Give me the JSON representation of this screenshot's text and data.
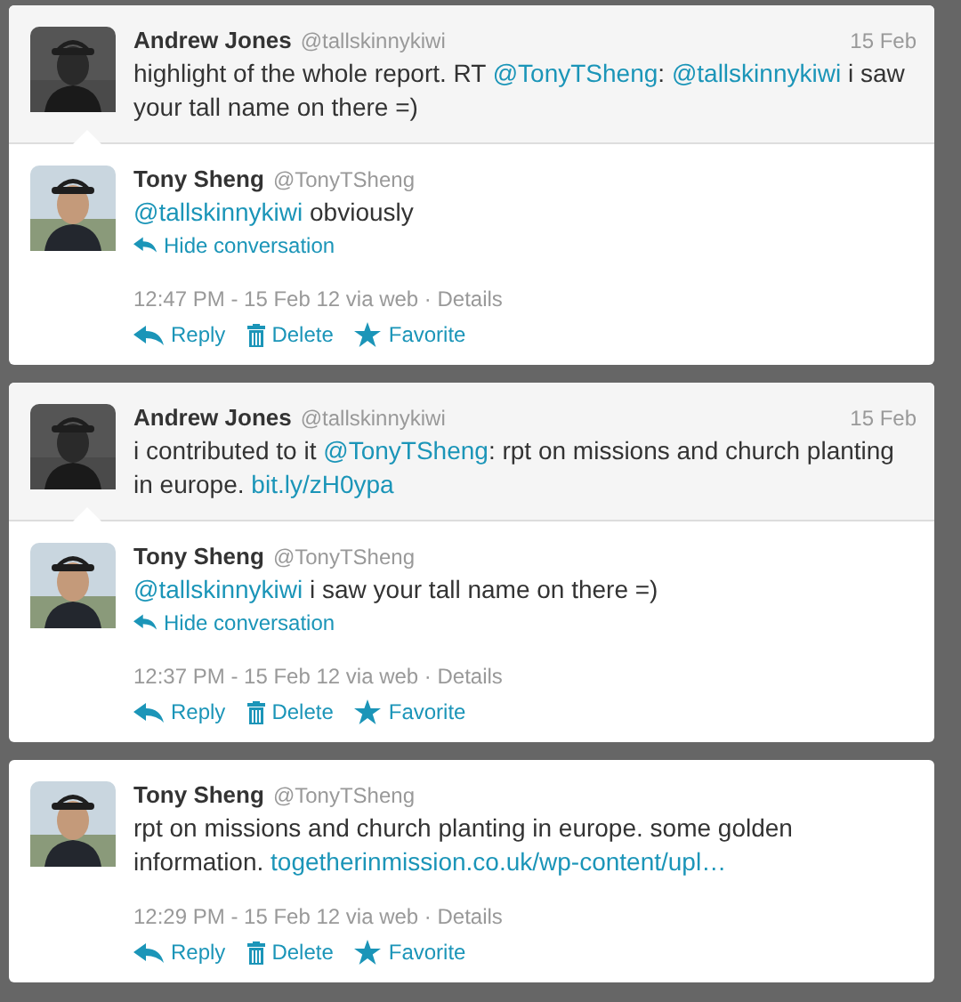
{
  "tweets": [
    {
      "parent": {
        "name": "Andrew Jones",
        "handle": "@tallskinnykiwi",
        "date": "15 Feb",
        "avatar": {
          "kind": "picture"
        },
        "text": [
          {
            "kind": "plain",
            "text": "highlight of the whole report. RT "
          },
          {
            "kind": "link",
            "text": "@TonyTSheng"
          },
          {
            "kind": "plain",
            "text": ": "
          },
          {
            "kind": "link",
            "text": "@tallskinnykiwi"
          },
          {
            "kind": "plain",
            "text": " i saw your tall name on there =)"
          }
        ]
      },
      "name": "Tony Sheng",
      "handle": "@TonyTSheng",
      "avatar": {
        "kind": "picture"
      },
      "text": [
        {
          "kind": "link",
          "text": "@tallskinnykiwi"
        },
        {
          "kind": "plain",
          "text": " obviously"
        }
      ],
      "conversation_link": "Hide conversation",
      "meta": "12:47 PM - 15 Feb 12 via web · Details",
      "actions": [
        {
          "kind": "reply",
          "label": "Reply"
        },
        {
          "kind": "delete",
          "label": "Delete"
        },
        {
          "kind": "favorite",
          "label": "Favorite"
        }
      ]
    },
    {
      "parent": {
        "name": "Andrew Jones",
        "handle": "@tallskinnykiwi",
        "date": "15 Feb",
        "avatar": {
          "kind": "picture"
        },
        "text": [
          {
            "kind": "plain",
            "text": "i contributed to it "
          },
          {
            "kind": "link",
            "text": "@TonyTSheng"
          },
          {
            "kind": "plain",
            "text": ": rpt on missions and church planting in europe. "
          },
          {
            "kind": "link",
            "text": "bit.ly/zH0ypa"
          }
        ]
      },
      "name": "Tony Sheng",
      "handle": "@TonyTSheng",
      "avatar": {
        "kind": "picture"
      },
      "text": [
        {
          "kind": "link",
          "text": "@tallskinnykiwi"
        },
        {
          "kind": "plain",
          "text": " i saw your tall name on there =)"
        }
      ],
      "conversation_link": "Hide conversation",
      "meta": "12:37 PM - 15 Feb 12 via web · Details",
      "actions": [
        {
          "kind": "reply",
          "label": "Reply"
        },
        {
          "kind": "delete",
          "label": "Delete"
        },
        {
          "kind": "favorite",
          "label": "Favorite"
        }
      ]
    },
    {
      "name": "Tony Sheng",
      "handle": "@TonyTSheng",
      "avatar": {
        "kind": "picture"
      },
      "text": [
        {
          "kind": "plain",
          "text": "rpt on missions and church planting in europe. some golden information. "
        },
        {
          "kind": "link",
          "text": "togetherinmission.co.uk/wp-content/upl…"
        }
      ],
      "meta": "12:29 PM - 15 Feb 12 via web · Details",
      "actions": [
        {
          "kind": "reply",
          "label": "Reply"
        },
        {
          "kind": "delete",
          "label": "Delete"
        },
        {
          "kind": "favorite",
          "label": "Favorite"
        }
      ]
    }
  ]
}
